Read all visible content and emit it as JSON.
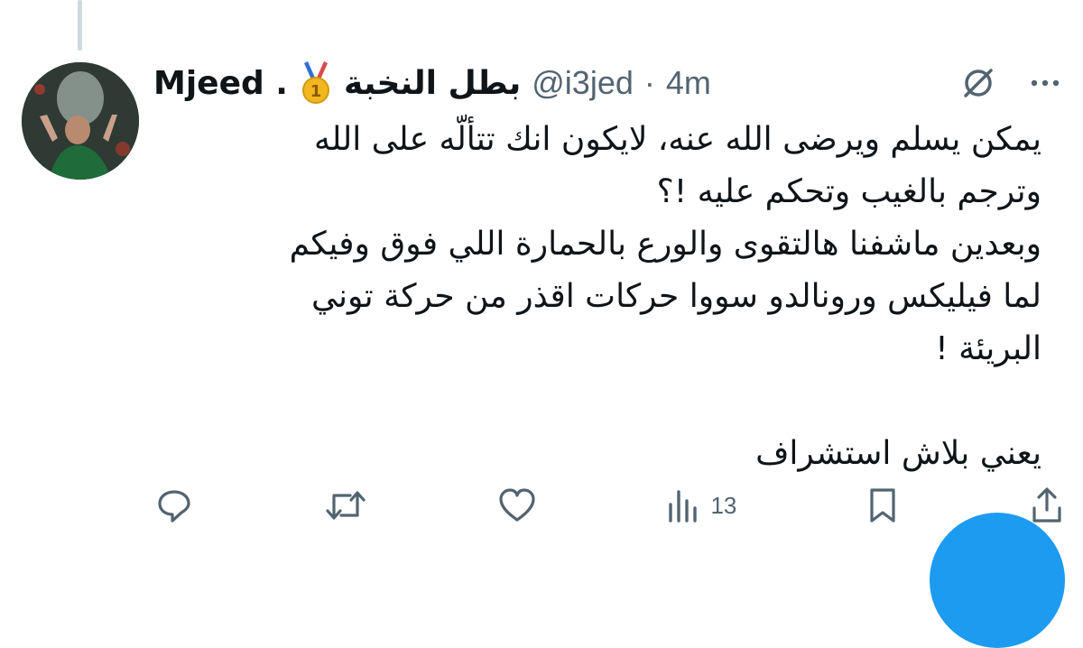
{
  "tweet": {
    "display_name": "Mjeed .",
    "name_arabic": "بطل النخبة",
    "handle": "@i3jed",
    "separator": "·",
    "time": "4m",
    "body_lines": [
      "يمكن يسلم ويرضى الله عنه،  لايكون انك تتألّه على الله",
      "وترجم بالغيب وتحكم عليه !؟",
      "وبعدين ماشفنا هالتقوى والورع بالحمارة اللي فوق وفيكم",
      "لما فيليكس ورونالدو سووا حركات اقذر من حركة توني",
      "البريئة !"
    ],
    "body_last": "يعني بلاش استشراف"
  },
  "actions": {
    "views_count": "13"
  },
  "icons": {
    "medal": "medal-icon",
    "grok": "grok-icon",
    "more": "more-icon",
    "reply": "reply-icon",
    "retweet": "retweet-icon",
    "like": "like-icon",
    "views": "views-icon",
    "bookmark": "bookmark-icon",
    "share": "share-icon"
  },
  "colors": {
    "text": "#0f1419",
    "muted": "#536471",
    "accent": "#1d9bf0"
  }
}
